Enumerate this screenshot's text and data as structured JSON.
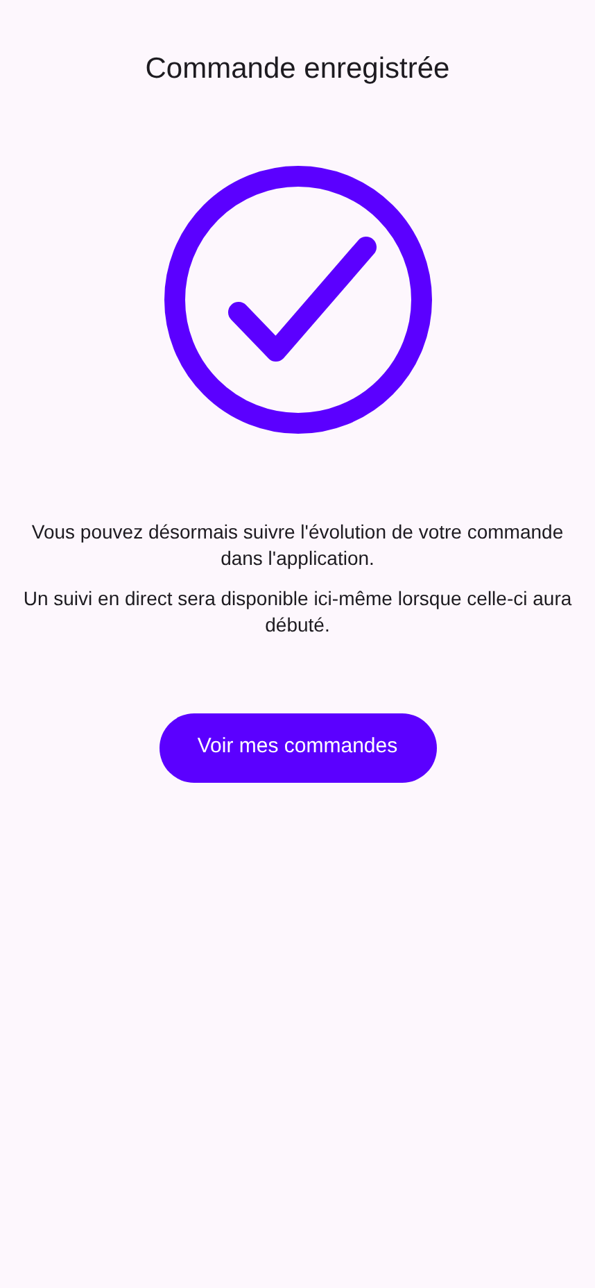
{
  "title": "Commande enregistrée",
  "messages": [
    "Vous pouvez désormais suivre l'évolution de votre commande dans l'application.",
    "Un suivi en direct sera disponible ici-même lorsque celle-ci aura débuté."
  ],
  "button": {
    "label": "Voir mes commandes"
  }
}
